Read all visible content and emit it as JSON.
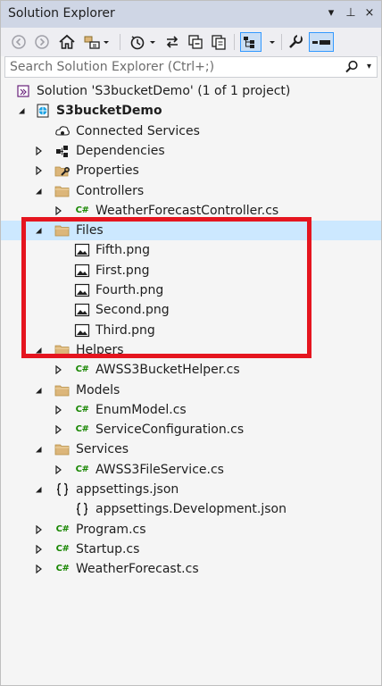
{
  "window": {
    "title": "Solution Explorer",
    "title_buttons": [
      "▾",
      "⊥",
      "×"
    ]
  },
  "toolbar": {
    "icons": [
      "back-icon",
      "forward-icon",
      "home-icon",
      "switch-views-icon",
      "pending-changes-icon",
      "sync-icon",
      "collapse-all-icon",
      "show-all-files-icon",
      "properties-icon",
      "preview-icon"
    ]
  },
  "search": {
    "placeholder": "Search Solution Explorer (Ctrl+;)"
  },
  "tree": [
    {
      "label": "Solution 'S3bucketDemo' (1 of 1 project)",
      "icon": "solution-icon",
      "expander": "none",
      "bold": false
    },
    {
      "label": "S3bucketDemo",
      "icon": "web-project-icon",
      "expander": "expanded",
      "bold": true
    },
    {
      "label": "Connected Services",
      "icon": "connected-services-icon",
      "expander": "none",
      "bold": false
    },
    {
      "label": "Dependencies",
      "icon": "dependencies-icon",
      "expander": "collapsed",
      "bold": false
    },
    {
      "label": "Properties",
      "icon": "properties-folder-icon",
      "expander": "collapsed",
      "bold": false
    },
    {
      "label": "Controllers",
      "icon": "folder-icon",
      "expander": "expanded",
      "bold": false
    },
    {
      "label": "WeatherForecastController.cs",
      "icon": "csharp-file-icon",
      "expander": "collapsed",
      "bold": false
    },
    {
      "label": "Files",
      "icon": "folder-icon",
      "expander": "expanded",
      "bold": false,
      "selected": true
    },
    {
      "label": "Fifth.png",
      "icon": "image-file-icon",
      "expander": "none",
      "bold": false
    },
    {
      "label": "First.png",
      "icon": "image-file-icon",
      "expander": "none",
      "bold": false
    },
    {
      "label": "Fourth.png",
      "icon": "image-file-icon",
      "expander": "none",
      "bold": false
    },
    {
      "label": "Second.png",
      "icon": "image-file-icon",
      "expander": "none",
      "bold": false
    },
    {
      "label": "Third.png",
      "icon": "image-file-icon",
      "expander": "none",
      "bold": false
    },
    {
      "label": "Helpers",
      "icon": "folder-icon",
      "expander": "expanded",
      "bold": false
    },
    {
      "label": "AWSS3BucketHelper.cs",
      "icon": "csharp-file-icon",
      "expander": "collapsed",
      "bold": false
    },
    {
      "label": "Models",
      "icon": "folder-icon",
      "expander": "expanded",
      "bold": false
    },
    {
      "label": "EnumModel.cs",
      "icon": "csharp-file-icon",
      "expander": "collapsed",
      "bold": false
    },
    {
      "label": "ServiceConfiguration.cs",
      "icon": "csharp-file-icon",
      "expander": "collapsed",
      "bold": false
    },
    {
      "label": "Services",
      "icon": "folder-icon",
      "expander": "expanded",
      "bold": false
    },
    {
      "label": "AWSS3FileService.cs",
      "icon": "csharp-file-icon",
      "expander": "collapsed",
      "bold": false
    },
    {
      "label": "appsettings.json",
      "icon": "json-file-icon",
      "expander": "expanded",
      "bold": false
    },
    {
      "label": "appsettings.Development.json",
      "icon": "json-file-icon",
      "expander": "none",
      "bold": false
    },
    {
      "label": "Program.cs",
      "icon": "csharp-file-icon",
      "expander": "collapsed",
      "bold": false
    },
    {
      "label": "Startup.cs",
      "icon": "csharp-file-icon",
      "expander": "collapsed",
      "bold": false
    },
    {
      "label": "WeatherForecast.cs",
      "icon": "csharp-file-icon",
      "expander": "collapsed",
      "bold": false
    }
  ],
  "colors": {
    "selection": "#cce8ff",
    "highlight_box": "#e5151f",
    "titlebar": "#cfd6e5",
    "csharp": "#178600",
    "folder": "#dcb67a"
  }
}
